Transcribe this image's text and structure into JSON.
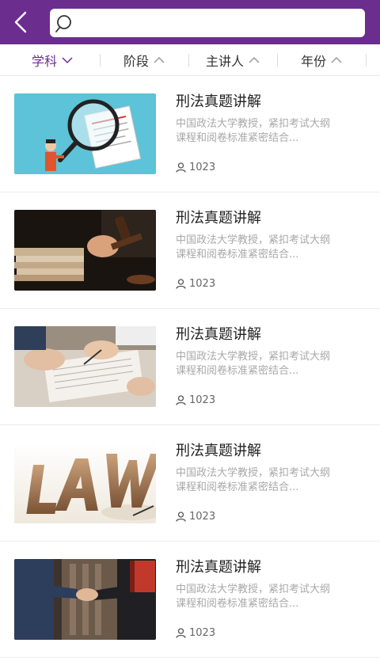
{
  "colors": {
    "header_bg": "#6b2d8e",
    "active_filter": "#6b2d8e",
    "title": "#222222",
    "desc": "#a8a8a8"
  },
  "header": {
    "back_icon": "chevron-left-icon",
    "search": {
      "icon": "search-icon",
      "value": "",
      "placeholder": ""
    }
  },
  "filters": [
    {
      "label": "学科",
      "arrow": "chevron-down-icon",
      "active": true
    },
    {
      "label": "阶段",
      "arrow": "chevron-up-icon",
      "active": false
    },
    {
      "label": "主讲人",
      "arrow": "chevron-up-icon",
      "active": false
    },
    {
      "label": "年份",
      "arrow": "chevron-up-icon",
      "active": false
    }
  ],
  "courses": [
    {
      "title": "刑法真题讲解",
      "desc_line1": "中国政法大学教授，紧扣考试大纲",
      "desc_line2": "课程和阅卷标准紧密结合...",
      "views": "1023",
      "image": "magnifier-document"
    },
    {
      "title": "刑法真题讲解",
      "desc_line1": "中国政法大学教授，紧扣考试大纲",
      "desc_line2": "课程和阅卷标准紧密结合...",
      "views": "1023",
      "image": "gavel-papers"
    },
    {
      "title": "刑法真题讲解",
      "desc_line1": "中国政法大学教授，紧扣考试大纲",
      "desc_line2": "课程和阅卷标准紧密结合...",
      "views": "1023",
      "image": "signing-document"
    },
    {
      "title": "刑法真题讲解",
      "desc_line1": "中国政法大学教授，紧扣考试大纲",
      "desc_line2": "课程和阅卷标准紧密结合...",
      "views": "1023",
      "image": "law-letters"
    },
    {
      "title": "刑法真题讲解",
      "desc_line1": "中国政法大学教授，紧扣考试大纲",
      "desc_line2": "课程和阅卷标准紧密结合...",
      "views": "1023",
      "image": "handshake"
    }
  ]
}
